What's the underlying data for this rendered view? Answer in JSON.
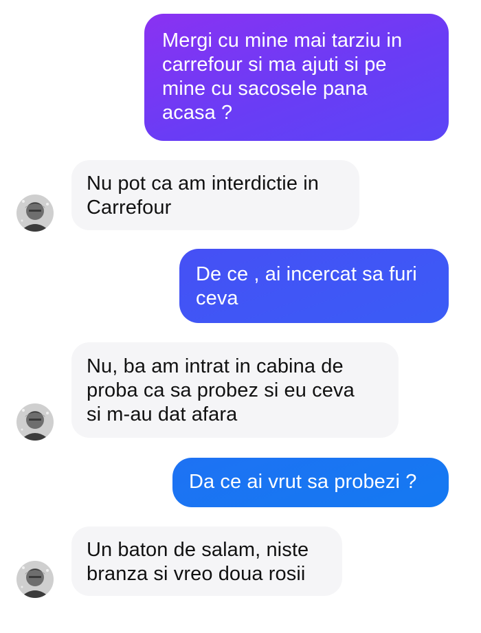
{
  "conversation": {
    "messages": [
      {
        "sender": "me",
        "text": "Mergi cu mine mai tarziu in\ncarrefour si ma ajuti si pe\nmine cu sacosele pana\nacasa ?"
      },
      {
        "sender": "contact",
        "text": "Nu pot ca am interdictie in\nCarrefour"
      },
      {
        "sender": "me",
        "text": "De ce , ai incercat sa furi\nceva"
      },
      {
        "sender": "contact",
        "text": "Nu, ba am intrat in cabina de\nproba ca sa probez si eu ceva\nsi m-au dat afara"
      },
      {
        "sender": "me",
        "text": "Da ce ai vrut sa probezi ?"
      },
      {
        "sender": "contact",
        "text": "Un baton de salam, niste\nbranza si vreo doua rosii"
      }
    ]
  },
  "avatar_icon": "contact-photo-avatar",
  "colors": {
    "outgoing_top": "#7a35f4",
    "outgoing_mid": "#3f57f6",
    "outgoing_bottom": "#1479f2",
    "incoming_bg": "#f5f5f7"
  }
}
